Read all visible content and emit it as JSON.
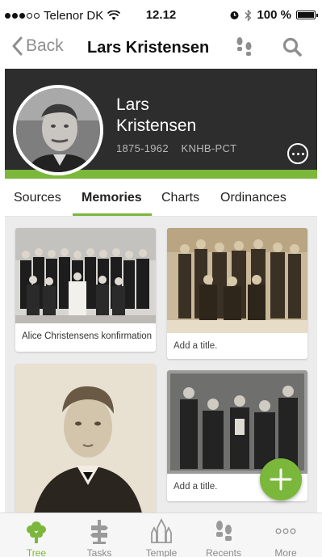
{
  "status_bar": {
    "carrier": "Telenor DK",
    "time": "12.12",
    "battery": "100 %"
  },
  "nav": {
    "back_label": "Back",
    "title": "Lars Kristensen"
  },
  "person": {
    "first_name": "Lars",
    "last_name": "Kristensen",
    "lifespan": "1875-1962",
    "pid": "KNHB-PCT"
  },
  "tabs": [
    {
      "label": "Sources",
      "active": false
    },
    {
      "label": "Memories",
      "active": true
    },
    {
      "label": "Charts",
      "active": false
    },
    {
      "label": "Ordinances",
      "active": false
    }
  ],
  "memories": [
    {
      "caption": "Alice Christensens konfirmation"
    },
    {
      "caption": "Add a title."
    },
    {
      "caption": ""
    },
    {
      "caption": "Add a title."
    }
  ],
  "bottom_tabs": [
    {
      "label": "Tree",
      "icon": "tree-icon",
      "active": true
    },
    {
      "label": "Tasks",
      "icon": "tasks-icon",
      "active": false
    },
    {
      "label": "Temple",
      "icon": "temple-icon",
      "active": false
    },
    {
      "label": "Recents",
      "icon": "recents-icon",
      "active": false
    },
    {
      "label": "More",
      "icon": "more-icon",
      "active": false
    }
  ],
  "colors": {
    "accent_green": "#7bb73b",
    "hero_background": "#2d2d2d",
    "muted_gray": "#8e8e8e"
  }
}
